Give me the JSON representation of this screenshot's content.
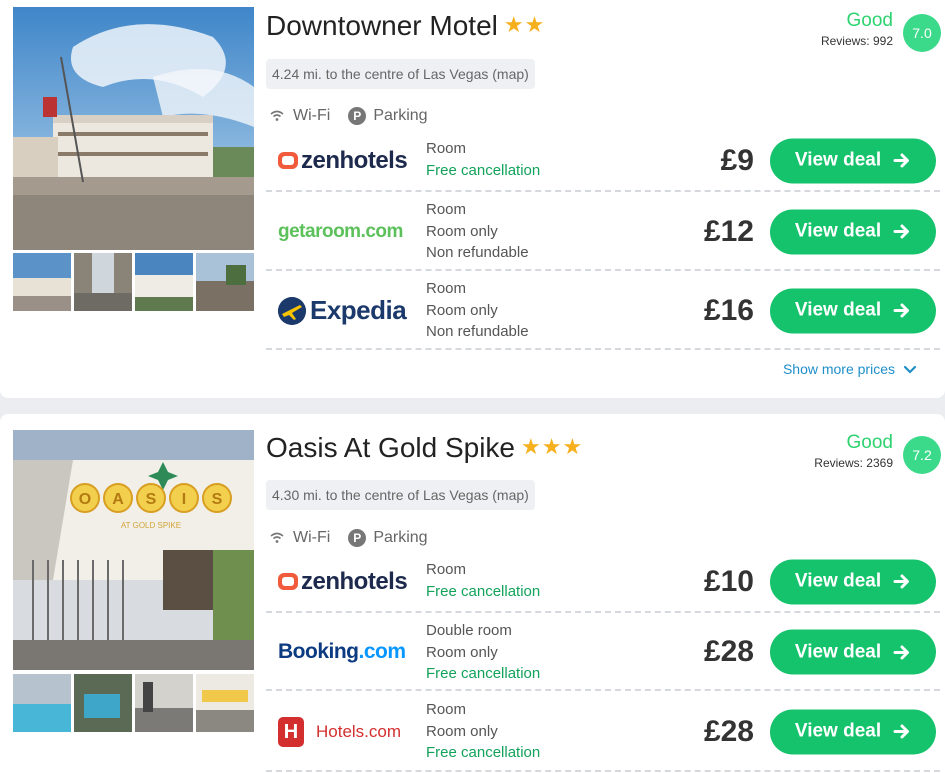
{
  "hotels": [
    {
      "name": "Downtowner Motel",
      "stars": "★★",
      "rating_word": "Good",
      "reviews": "Reviews: 992",
      "score": "7.0",
      "distance": "4.24 mi. to the centre of Las Vegas (map)",
      "amenities": [
        "Wi-Fi",
        "Parking"
      ],
      "deals": [
        {
          "provider": "zenhotels",
          "room": [
            "Room",
            "Free cancellation"
          ],
          "price": "£9",
          "button": "View deal"
        },
        {
          "provider": "getaroom.com",
          "room": [
            "Room",
            "Room only",
            "Non refundable"
          ],
          "price": "£12",
          "button": "View deal"
        },
        {
          "provider": "Expedia",
          "room": [
            "Room",
            "Room only",
            "Non refundable"
          ],
          "price": "£16",
          "button": "View deal"
        }
      ],
      "show_more": "Show more prices"
    },
    {
      "name": "Oasis At Gold Spike",
      "stars": "★★★",
      "rating_word": "Good",
      "reviews": "Reviews: 2369",
      "score": "7.2",
      "distance": "4.30 mi. to the centre of Las Vegas (map)",
      "amenities": [
        "Wi-Fi",
        "Parking"
      ],
      "photo_sign": "OASIS",
      "photo_subsign": "AT GOLD SPIKE",
      "deals": [
        {
          "provider": "zenhotels",
          "room": [
            "Room",
            "Free cancellation"
          ],
          "price": "£10",
          "button": "View deal"
        },
        {
          "provider_main": "Booking",
          "provider_suffix": ".com",
          "room": [
            "Double room",
            "Room only",
            "Free cancellation"
          ],
          "price": "£28",
          "button": "View deal"
        },
        {
          "provider": "Hotels.com",
          "room": [
            "Room",
            "Room only",
            "Free cancellation"
          ],
          "price": "£28",
          "button": "View deal"
        }
      ]
    }
  ],
  "colors": {
    "accent_green": "#14c36b",
    "rating_green": "#3bd98a",
    "link_blue": "#1f8fc9",
    "star_gold": "#f6b01e"
  },
  "icons": [
    "wifi-icon",
    "parking-icon",
    "arrow-right-icon",
    "chevron-down-icon",
    "star-icon"
  ]
}
